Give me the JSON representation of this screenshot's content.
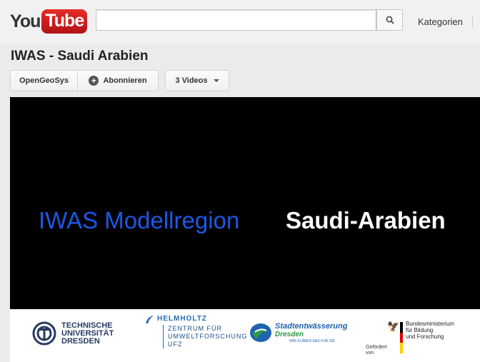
{
  "header": {
    "logo_you": "You",
    "logo_tube": "Tube",
    "search_placeholder": "",
    "categories_label": "Kategorien"
  },
  "channel": {
    "title": "IWAS - Saudi Arabien",
    "owner_button": "OpenGeoSys",
    "subscribe_button": "Abonnieren",
    "videos_button": "3 Videos"
  },
  "video": {
    "title_part1": "IWAS Modellregion",
    "title_part2": "Saudi-Arabien"
  },
  "sponsors": {
    "tud_lines": [
      "TECHNISCHE",
      "UNIVERSITÄT",
      "DRESDEN"
    ],
    "ufz_title": "HELMHOLTZ",
    "ufz_lines": [
      "ZENTRUM FÜR",
      "UMWELTFORSCHUNG",
      "UFZ"
    ],
    "se_name": "Stadtentwässerung",
    "se_city": "Dresden",
    "se_slogan": "WIR KLÄREN DAS FÜR SIE",
    "bmbf_funded": "Gefördert",
    "bmbf_by": "von",
    "bmbf_lines": [
      "Bundesministerium",
      "für Bildung",
      "und Forschung"
    ]
  },
  "colors": {
    "accent_red": "#cc181e",
    "video_title_blue": "#1d57e8"
  },
  "icons": {
    "search": "search-icon",
    "subscribe": "plus-circle-icon",
    "dropdown": "chevron-down-icon"
  }
}
